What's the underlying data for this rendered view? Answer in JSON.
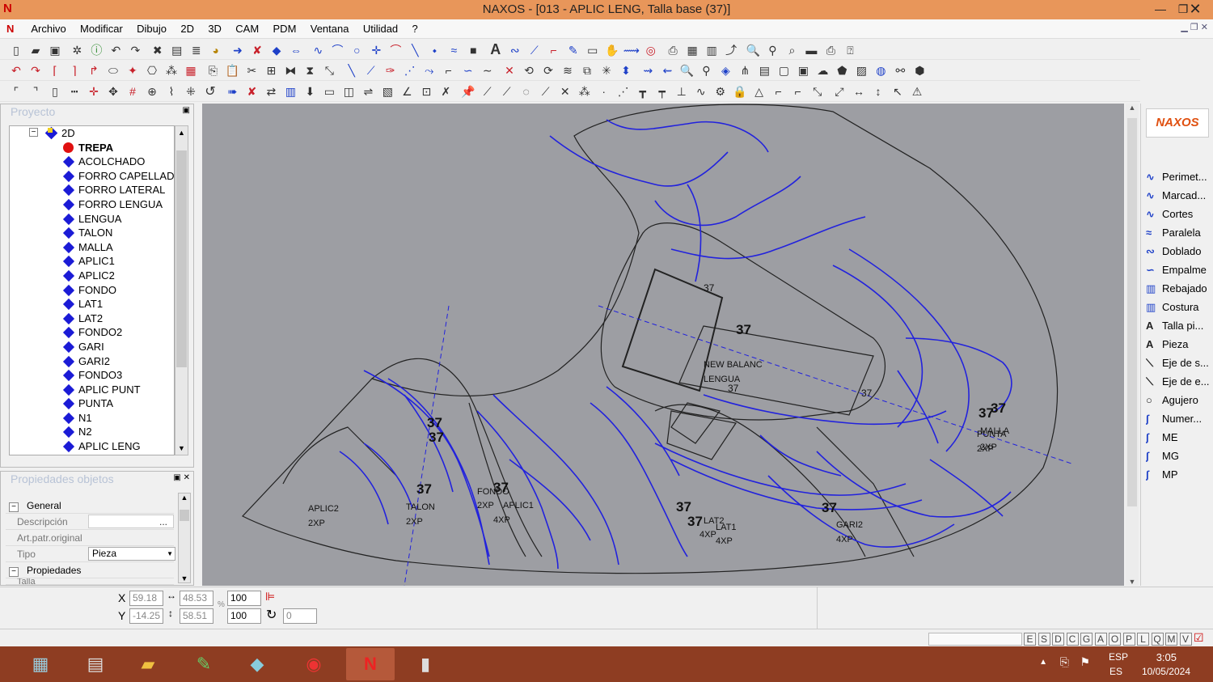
{
  "window": {
    "title": "NAXOS - [013 - APLIC LENG, Talla base (37)]"
  },
  "menu": [
    "Archivo",
    "Modificar",
    "Dibujo",
    "2D",
    "3D",
    "CAM",
    "PDM",
    "Ventana",
    "Utilidad",
    "?"
  ],
  "project_panel": {
    "title": "Proyecto",
    "root": "2D",
    "selected": "TREPA",
    "items": [
      "ACOLCHADO",
      "FORRO CAPELLADA",
      "FORRO LATERAL",
      "FORRO LENGUA",
      "LENGUA",
      "TALON",
      "MALLA",
      "APLIC1",
      "APLIC2",
      "FONDO",
      "LAT1",
      "LAT2",
      "FONDO2",
      "GARI",
      "GARI2",
      "FONDO3",
      "APLIC PUNT",
      "PUNTA",
      "N1",
      "N2",
      "APLIC LENG"
    ]
  },
  "props_panel": {
    "title": "Propiedades objetos",
    "section_general": "General",
    "descripcion_label": "Descripción",
    "art_label": "Art.patr.original",
    "tipo_label": "Tipo",
    "tipo_value": "Pieza",
    "section_props": "Propiedades",
    "ellipsis": "...",
    "talla_partial": "Talla"
  },
  "canvas_labels": [
    {
      "t": "37",
      "s": "big"
    },
    {
      "t": "37",
      "s": "big"
    },
    {
      "t": "APLIC2",
      "s": "sm"
    },
    {
      "t": "2XP",
      "s": "sm"
    },
    {
      "t": "37",
      "s": "big"
    },
    {
      "t": "TALON",
      "s": "sm"
    },
    {
      "t": "2XP",
      "s": "sm"
    },
    {
      "t": "FONDO",
      "s": "sm"
    },
    {
      "t": "37",
      "s": "big"
    },
    {
      "t": "2XP",
      "s": "sm"
    },
    {
      "t": "APLIC1",
      "s": "sm"
    },
    {
      "t": "4XP",
      "s": "sm"
    },
    {
      "t": "37",
      "s": "big"
    },
    {
      "t": "37",
      "s": "big"
    },
    {
      "t": "LAT2",
      "s": "sm"
    },
    {
      "t": "LAT1",
      "s": "sm"
    },
    {
      "t": "4XP",
      "s": "sm"
    },
    {
      "t": "4XP",
      "s": "sm"
    },
    {
      "t": "37",
      "s": "big"
    },
    {
      "t": "GARI2",
      "s": "sm"
    },
    {
      "t": "4XP",
      "s": "sm"
    },
    {
      "t": "37",
      "s": "big"
    },
    {
      "t": "NEW BALANC",
      "s": "sm"
    },
    {
      "t": "LENGUA",
      "s": "sm"
    },
    {
      "t": "37",
      "s": "med"
    },
    {
      "t": "37",
      "s": "big"
    },
    {
      "t": "37",
      "s": "big"
    },
    {
      "t": "MALLA",
      "s": "sm"
    },
    {
      "t": "PUNTA",
      "s": "sm"
    },
    {
      "t": "2XP",
      "s": "sm"
    },
    {
      "t": "2XP",
      "s": "sm"
    },
    {
      "t": "37",
      "s": "med"
    },
    {
      "t": "37",
      "s": "med"
    }
  ],
  "right_panel": {
    "logo": "NAXOS",
    "items": [
      {
        "icon": "curve-icon",
        "label": "Perimet..."
      },
      {
        "icon": "curve-icon",
        "label": "Marcad..."
      },
      {
        "icon": "curve-icon",
        "label": "Cortes"
      },
      {
        "icon": "parallel-icon",
        "label": "Paralela"
      },
      {
        "icon": "fold-icon",
        "label": "Doblado"
      },
      {
        "icon": "join-icon",
        "label": "Empalme"
      },
      {
        "icon": "skive-icon",
        "label": "Rebajado"
      },
      {
        "icon": "seam-icon",
        "label": "Costura"
      },
      {
        "icon": "text-icon",
        "label": "Talla pi..."
      },
      {
        "icon": "text-icon",
        "label": "Pieza"
      },
      {
        "icon": "axis-icon",
        "label": "Eje de s..."
      },
      {
        "icon": "axis-icon",
        "label": "Eje de e..."
      },
      {
        "icon": "hole-icon",
        "label": "Agujero"
      },
      {
        "icon": "number-icon",
        "label": "Numer..."
      },
      {
        "icon": "number-icon",
        "label": "ME"
      },
      {
        "icon": "number-icon",
        "label": "MG"
      },
      {
        "icon": "number-icon",
        "label": "MP"
      }
    ]
  },
  "coords": {
    "x_label": "X",
    "y_label": "Y",
    "x": "59.18",
    "y": "-14.25",
    "w": "48.53",
    "h": "58.51",
    "scale_x": "100",
    "scale_y": "100",
    "rotation": "0",
    "percent": "%"
  },
  "status_letters": [
    "E",
    "S",
    "D",
    "C",
    "G",
    "A",
    "O",
    "P",
    "L",
    "Q",
    "M",
    "V"
  ],
  "tray": {
    "lang1": "ESP",
    "lang2": "ES",
    "time": "3:05",
    "date": "10/05/2024"
  }
}
